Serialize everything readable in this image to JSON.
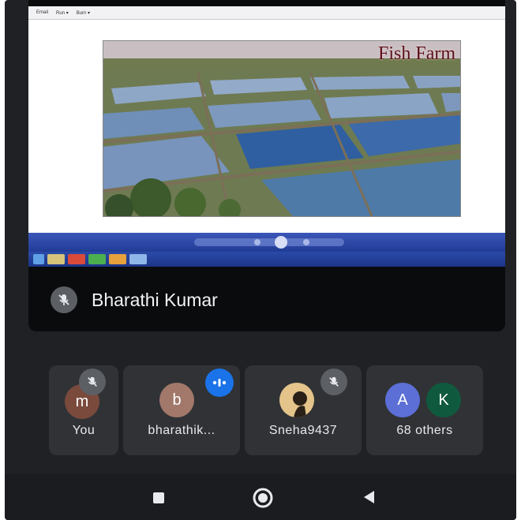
{
  "shared_screen": {
    "menu_items": [
      "Email",
      "Run ▾",
      "Burn ▾"
    ],
    "slide_title": "Fish Farm"
  },
  "presenter": {
    "name": "Bharathi Kumar",
    "mic": "muted"
  },
  "participants": [
    {
      "name": "You",
      "avatar_letter": "m",
      "avatar_color": "#7a4a3c",
      "status": "muted"
    },
    {
      "name": "bharathik...",
      "avatar_letter": "b",
      "avatar_color": "#a1786a",
      "status": "speaking"
    },
    {
      "name": "Sneha9437",
      "avatar_letter": "",
      "avatar_color": "#e4c48a",
      "status": "muted"
    },
    {
      "name": "68 others",
      "avatar_letters": [
        "A",
        "K"
      ],
      "avatar_colors": [
        "#5b6fd6",
        "#0f5a3e"
      ]
    }
  ],
  "colors": {
    "background": "#1f2124",
    "tile": "#303236",
    "speaking_badge": "#1a73e8",
    "muted_badge": "#5c5f64"
  },
  "nav": {
    "icons": [
      "recents-square-icon",
      "home-circle-icon",
      "back-triangle-icon"
    ]
  }
}
